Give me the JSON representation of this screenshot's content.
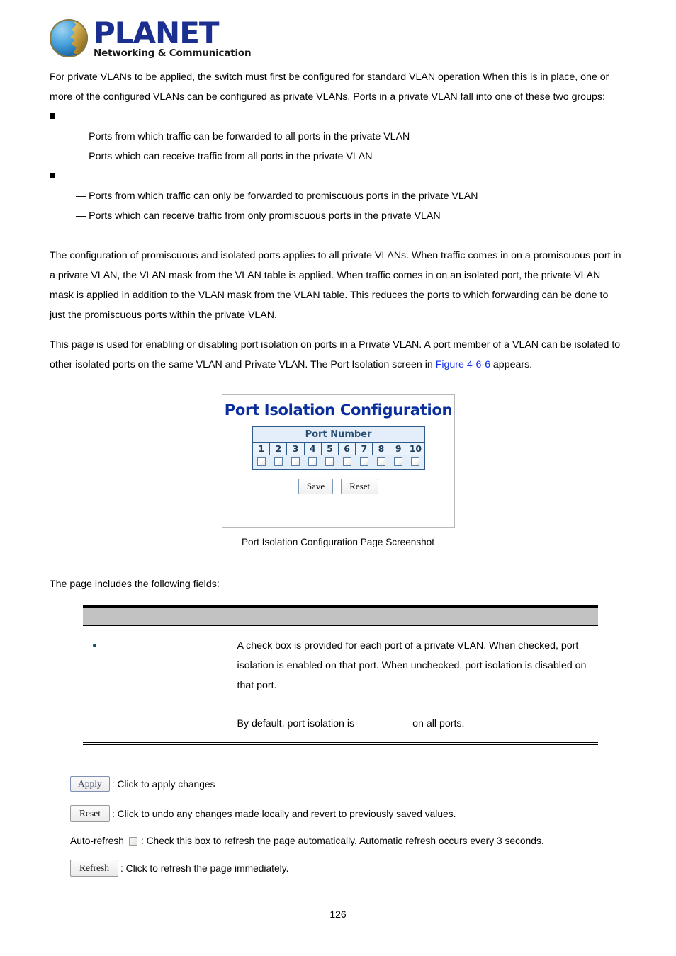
{
  "brand": {
    "name": "PLANET",
    "tagline": "Networking & Communication",
    "logo_icon": "planet-globe-icon",
    "text_color": "#1a2f8f"
  },
  "intro": {
    "paragraph_1": "For private VLANs to be applied, the switch must first be configured for standard VLAN operation When this is in place, one or more of the configured VLANs can be configured as private VLANs. Ports in a private VLAN fall into one of these two groups:",
    "groups": [
      {
        "marker": "square-bullet-icon",
        "label": "",
        "lines": [
          "— Ports from which traffic can be forwarded to all ports in the private VLAN",
          "— Ports which can receive traffic from all ports in the private VLAN"
        ]
      },
      {
        "marker": "square-bullet-icon",
        "label": "",
        "lines": [
          "— Ports from which traffic can only be forwarded to promiscuous ports in the private VLAN",
          "— Ports which can receive traffic from only promiscuous ports in the private VLAN"
        ]
      }
    ],
    "paragraph_2": "The configuration of promiscuous and isolated ports applies to all private VLANs. When traffic comes in on a promiscuous port in a private VLAN, the VLAN mask from the VLAN table is applied. When traffic comes in on an isolated port, the private VLAN mask is applied in addition to the VLAN mask from the VLAN table. This reduces the ports to which forwarding can be done to just the promiscuous ports within the private VLAN.",
    "paragraph_3_before": "This page is used for enabling or disabling port isolation on ports in a Private VLAN. A port member of a VLAN can be isolated to other isolated ports on the same VLAN and Private VLAN. The Port Isolation screen in ",
    "figure_link": "Figure 4-6-6",
    "figure_link_color": "#1430e8",
    "paragraph_3_after": " appears."
  },
  "screenshot": {
    "title": "Port Isolation Configuration",
    "title_color": "#0a2f9c",
    "table_caption": "Port Number",
    "port_numbers": [
      "1",
      "2",
      "3",
      "4",
      "5",
      "6",
      "7",
      "8",
      "9",
      "10"
    ],
    "checkbox_states": [
      false,
      false,
      false,
      false,
      false,
      false,
      false,
      false,
      false,
      false
    ],
    "buttons": [
      {
        "label": "Save",
        "name": "save-button"
      },
      {
        "label": "Reset",
        "name": "reset-button"
      }
    ],
    "border_color": "#2e5c8a",
    "table_bg": "#e3eefa"
  },
  "figure_caption": "Port Isolation Configuration Page Screenshot",
  "fields_section": {
    "intro": "The page includes the following fields:",
    "header": {
      "object_col": "",
      "description_col": ""
    },
    "rows": [
      {
        "marker": "blue-dot-icon",
        "object": "",
        "description_part_1": "A check box is provided for each port of a private VLAN. When checked, port isolation is enabled on that port. When unchecked, port isolation is disabled on that port.",
        "description_part_2_before": "By default, port isolation is",
        "description_part_2_gap": "",
        "description_part_2_after": "on all ports."
      }
    ],
    "header_bg": "#c2c2c2"
  },
  "button_legend": [
    {
      "button_label": "Apply",
      "button_name": "apply-button",
      "description": ": Click to apply changes"
    },
    {
      "button_label": "Reset",
      "button_name": "reset-legend-button",
      "description": ": Click to undo any changes made locally and revert to previously saved values."
    }
  ],
  "auto_refresh": {
    "label": "Auto-refresh",
    "checkbox_name": "auto-refresh-checkbox",
    "checked": false,
    "description": ": Check this box to refresh the page automatically. Automatic refresh occurs every 3 seconds."
  },
  "refresh_row": {
    "button_label": "Refresh",
    "description": ": Click to refresh the page immediately."
  },
  "page_number": "126"
}
